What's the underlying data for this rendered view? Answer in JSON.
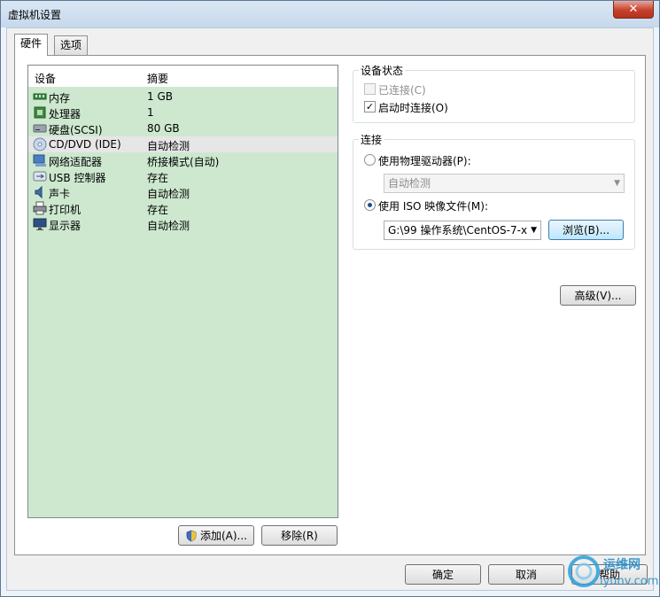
{
  "window": {
    "title": "虚拟机设置"
  },
  "tabs": [
    {
      "label": "硬件"
    },
    {
      "label": "选项"
    }
  ],
  "hardware": {
    "col_device": "设备",
    "col_summary": "摘要",
    "items": [
      {
        "name": "内存",
        "summary": "1 GB",
        "icon": "memory-icon"
      },
      {
        "name": "处理器",
        "summary": "1",
        "icon": "processor-icon"
      },
      {
        "name": "硬盘(SCSI)",
        "summary": "80 GB",
        "icon": "hard-disk-icon"
      },
      {
        "name": "CD/DVD (IDE)",
        "summary": "自动检测",
        "icon": "cd-dvd-icon",
        "selected": true
      },
      {
        "name": "网络适配器",
        "summary": "桥接模式(自动)",
        "icon": "network-adapter-icon"
      },
      {
        "name": "USB 控制器",
        "summary": "存在",
        "icon": "usb-icon"
      },
      {
        "name": "声卡",
        "summary": "自动检测",
        "icon": "sound-card-icon"
      },
      {
        "name": "打印机",
        "summary": "存在",
        "icon": "printer-icon"
      },
      {
        "name": "显示器",
        "summary": "自动检测",
        "icon": "display-icon"
      }
    ],
    "add_label": "添加(A)...",
    "remove_label": "移除(R)"
  },
  "device_status": {
    "title": "设备状态",
    "connected_label": "已连接(C)",
    "connected": false,
    "connect_at_power_on_label": "启动时连接(O)",
    "connect_at_power_on": true
  },
  "connection": {
    "title": "连接",
    "physical_drive_label": "使用物理驱动器(P):",
    "physical_drive_value": "自动检测",
    "iso_label": "使用 ISO 映像文件(M):",
    "iso_value": "G:\\99 操作系统\\CentOS-7-x",
    "browse_label": "浏览(B)...",
    "selected": "iso"
  },
  "advanced_label": "高级(V)...",
  "footer": {
    "ok_label": "确定",
    "cancel_label": "取消",
    "help_label": "帮助"
  },
  "watermark": {
    "text1": "运维网",
    "text2": "iyunv.com"
  },
  "colors": {
    "list_background": "#cde8cf",
    "selected_row": "#e6e6e6",
    "close_button": "#c7402b"
  }
}
